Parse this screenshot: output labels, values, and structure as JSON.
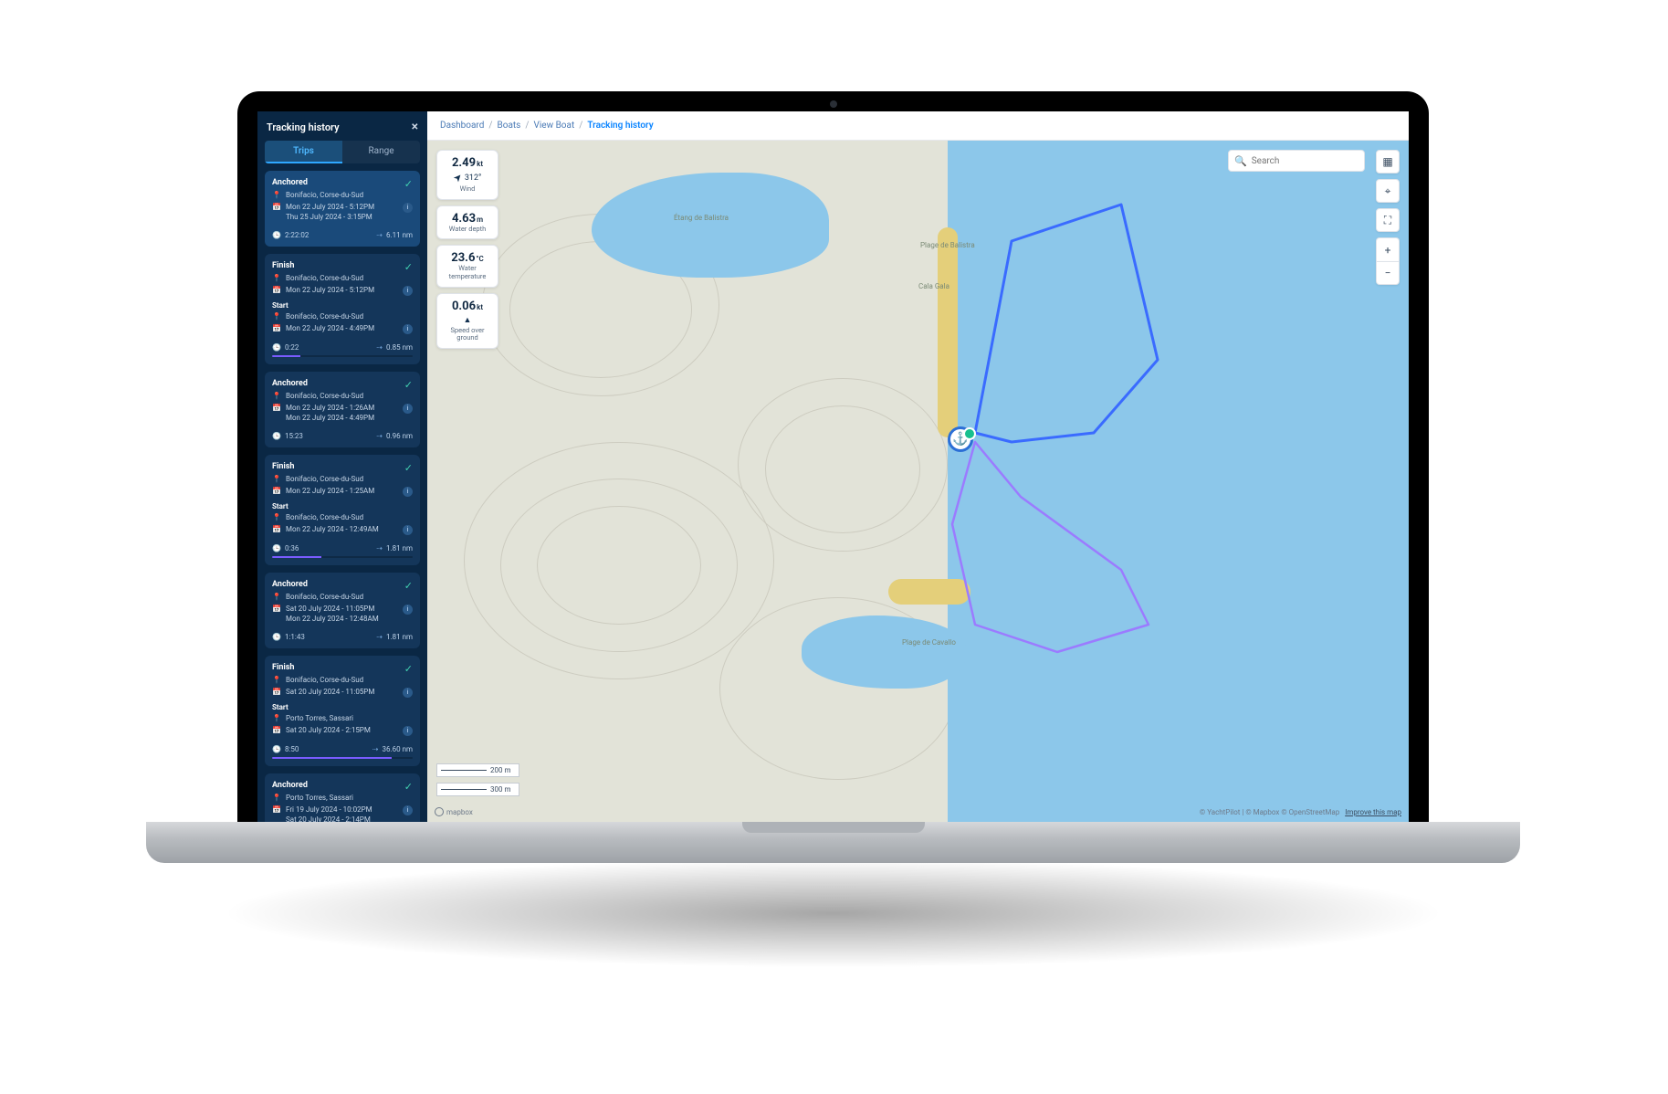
{
  "breadcrumb": {
    "items": [
      "Dashboard",
      "Boats",
      "View Boat",
      "Tracking history"
    ]
  },
  "sidebar": {
    "title": "Tracking history",
    "tabs": {
      "trips": "Trips",
      "range": "Range"
    },
    "cards": [
      {
        "type": "Anchored",
        "selected": true,
        "loc": "Bonifacio, Corse-du-Sud",
        "from": "Mon 22 July 2024 - 5:12PM",
        "to": "Thu 25 July 2024 - 3:15PM",
        "dur": "2:22:02",
        "dist": "6.11 nm"
      },
      {
        "type": "pair",
        "finish": {
          "loc": "Bonifacio, Corse-du-Sud",
          "time": "Mon 22 July 2024 - 5:12PM"
        },
        "start": {
          "loc": "Bonifacio, Corse-du-Sud",
          "time": "Mon 22 July 2024 - 4:49PM"
        },
        "dur": "0:22",
        "dist": "0.85 nm",
        "prog": 20
      },
      {
        "type": "Anchored",
        "loc": "Bonifacio, Corse-du-Sud",
        "from": "Mon 22 July 2024 - 1:26AM",
        "to": "Mon 22 July 2024 - 4:49PM",
        "dur": "15:23",
        "dist": "0.96 nm"
      },
      {
        "type": "pair",
        "finish": {
          "loc": "Bonifacio, Corse-du-Sud",
          "time": "Mon 22 July 2024 - 1:25AM"
        },
        "start": {
          "loc": "Bonifacio, Corse-du-Sud",
          "time": "Mon 22 July 2024 - 12:49AM"
        },
        "dur": "0:36",
        "dist": "1.81 nm",
        "prog": 35
      },
      {
        "type": "Anchored",
        "loc": "Bonifacio, Corse-du-Sud",
        "from": "Sat 20 July 2024 - 11:05PM",
        "to": "Mon 22 July 2024 - 12:48AM",
        "dur": "1:1:43",
        "dist": "1.81 nm"
      },
      {
        "type": "pair",
        "finish": {
          "loc": "Bonifacio, Corse-du-Sud",
          "time": "Sat 20 July 2024 - 11:05PM"
        },
        "start": {
          "loc": "Porto Torres, Sassari",
          "time": "Sat 20 July 2024 - 2:15PM"
        },
        "dur": "8:50",
        "dist": "36.60 nm",
        "prog": 85
      },
      {
        "type": "Anchored",
        "loc": "Porto Torres, Sassari",
        "from": "Fri 19 July 2024 - 10:02PM",
        "to": "Sat 20 July 2024 - 2:14PM",
        "dur": "",
        "dist": ""
      }
    ]
  },
  "stats": {
    "wind": {
      "value": "2.49",
      "unit": "kt",
      "bearing": "312°",
      "arrow": "➤",
      "label": "Wind"
    },
    "depth": {
      "value": "4.63",
      "unit": "m",
      "label": "Water depth"
    },
    "temp": {
      "value": "23.6",
      "unit": "°C",
      "label": "Water temperature"
    },
    "sog": {
      "value": "0.06",
      "unit": "kt",
      "arrow": "▲",
      "label": "Speed over ground"
    }
  },
  "search": {
    "placeholder": "Search",
    "icon": "🔍"
  },
  "controls": {
    "layers": "▦",
    "locate": "⌖",
    "fullscreen": "⛶",
    "zoom_in": "+",
    "zoom_out": "−"
  },
  "scale": {
    "a": "200 m",
    "b": "300 m"
  },
  "attrib": {
    "left": "mapbox",
    "right": "© YachtPilot | © Mapbox © OpenStreetMap",
    "improve": "Improve this map"
  },
  "poi": {
    "etang": "Étang de Balistra",
    "plage1": "Plage de Balistra",
    "gala": "Cala Gala",
    "plage2": "Plage de Cavallo"
  },
  "labels": {
    "start": "Start",
    "finish": "Finish"
  }
}
